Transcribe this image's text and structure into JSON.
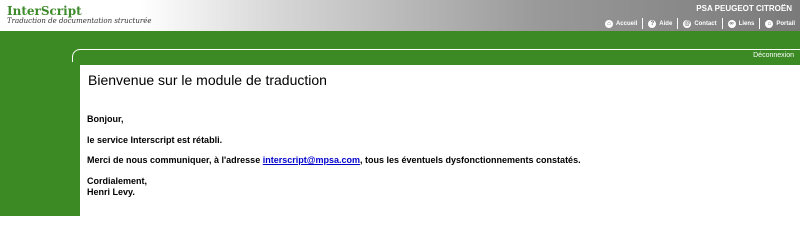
{
  "header": {
    "app_name": "InterScript",
    "app_subtitle": "Traduction de documentation structurée",
    "corporate": "PSA PEUGEOT CITROËN",
    "toolbar": [
      {
        "label": "Accueil",
        "icon": "home-icon"
      },
      {
        "label": "Aide",
        "icon": "help-icon"
      },
      {
        "label": "Contact",
        "icon": "contact-icon"
      },
      {
        "label": "Liens",
        "icon": "links-icon"
      },
      {
        "label": "Portail",
        "icon": "portal-icon"
      }
    ],
    "logout_label": "Déconnexion"
  },
  "main": {
    "title": "Bienvenue sur le module de traduction",
    "greeting": "Bonjour,",
    "line1": "le service Interscript est rétabli.",
    "line2_prefix": "Merci de nous communiquer, à l'adresse ",
    "email": "interscript@mpsa.com",
    "line2_suffix": ", tous les éventuels dysfonctionnements constatés.",
    "closing": "Cordialement,",
    "signature": "Henri Levy."
  },
  "colors": {
    "brand_green": "#3b8a24",
    "link": "#0000cc"
  }
}
